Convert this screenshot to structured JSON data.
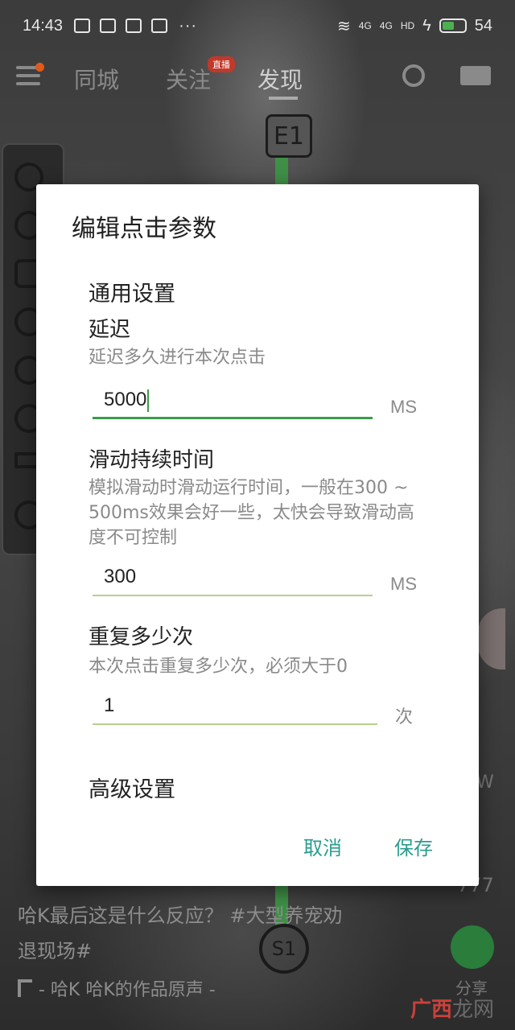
{
  "status_bar": {
    "time": "14:43",
    "network_badges": [
      "4G",
      "4G",
      "HD"
    ],
    "battery_level": "54"
  },
  "top_nav": {
    "tabs": [
      "同城",
      "关注",
      "发现"
    ],
    "live_badge": "直播"
  },
  "overlay_markers": {
    "top_marker": "E1",
    "bottom_marker": "S1"
  },
  "feed": {
    "caption_line1": "哈K最后这是什么反应？ #大型养宠劝",
    "caption_line2": "退现场#",
    "music": "- 哈K  哈K的作品原声 -",
    "like_count": "777",
    "side_label": "W",
    "share_label": "分享"
  },
  "dialog": {
    "title": "编辑点击参数",
    "general_section": "通用设置",
    "delay": {
      "label": "延迟",
      "description": "延迟多久进行本次点击",
      "value": "5000",
      "unit": "MS"
    },
    "swipe_duration": {
      "label": "滑动持续时间",
      "description": "模拟滑动时滑动运行时间，一般在300 ~ 500ms效果会好一些，太快会导致滑动高度不可控制",
      "value": "300",
      "unit": "MS"
    },
    "repeat": {
      "label": "重复多少次",
      "description": "本次点击重复多少次，必须大于0",
      "value": "1",
      "unit": "次"
    },
    "advanced_section": "高级设置",
    "cancel_label": "取消",
    "save_label": "保存"
  },
  "watermark": {
    "brand": "广西",
    "suffix": "龙网"
  },
  "colors": {
    "accent_green": "#3c9a4a",
    "button_teal": "#2a9d8f",
    "underline_light": "#b7d18e"
  }
}
